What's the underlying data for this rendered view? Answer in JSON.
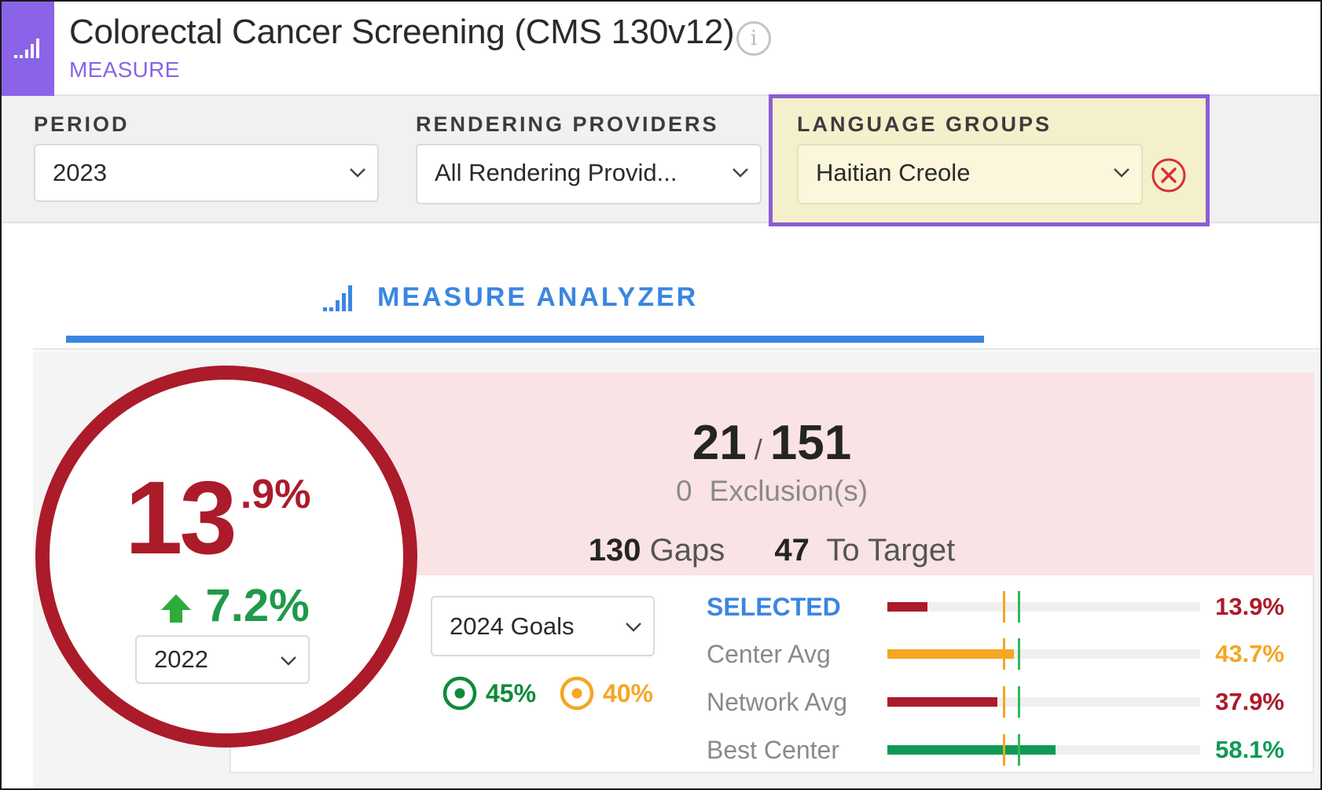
{
  "header": {
    "title": "Colorectal Cancer Screening (CMS 130v12)",
    "subtitle": "MEASURE",
    "info_glyph": "i"
  },
  "filters": {
    "period": {
      "label": "PERIOD",
      "value": "2023"
    },
    "providers": {
      "label": "RENDERING PROVIDERS",
      "value": "All Rendering Provid..."
    },
    "language": {
      "label": "LANGUAGE GROUPS",
      "value": "Haitian Creole"
    }
  },
  "tab": {
    "label": "MEASURE ANALYZER"
  },
  "summary": {
    "numerator": "21",
    "slash": "/",
    "denominator": "151",
    "exclusions_count": "0",
    "exclusions_label": "Exclusion(s)",
    "gaps_count": "130",
    "gaps_label": "Gaps",
    "to_target_count": "47",
    "to_target_label": "To Target"
  },
  "score": {
    "integer": "13",
    "decimal": ".9%",
    "delta": "7.2%",
    "compare_year": "2022"
  },
  "goals": {
    "select_label": "2024 Goals",
    "target_primary": "45%",
    "target_secondary": "40%"
  },
  "comparison": {
    "rows": [
      {
        "label": "SELECTED",
        "value": "13.9%",
        "percent": 13.9,
        "color": "#ab1b2a"
      },
      {
        "label": "Center Avg",
        "value": "43.7%",
        "percent": 43.7,
        "color": "#f5a623"
      },
      {
        "label": "Network Avg",
        "value": "37.9%",
        "percent": 37.9,
        "color": "#ab1b2a"
      },
      {
        "label": "Best Center",
        "value": "58.1%",
        "percent": 58.1,
        "color": "#0e9a54"
      }
    ],
    "goal_secondary_percent": 40,
    "goal_primary_percent": 45
  },
  "colors": {
    "accent_purple": "#8b63e8",
    "tab_blue": "#3a86e2",
    "score_red": "#ab1b2a",
    "delta_green": "#1e9a4a",
    "goal_green": "#0e8a3a",
    "goal_orange": "#f5a623"
  },
  "icons": {
    "header": "signal-bars-icon",
    "info": "info-icon",
    "clear": "close-circle-icon",
    "tab": "signal-bars-icon",
    "delta": "arrow-up-icon",
    "goal_primary": "target-icon",
    "goal_secondary": "target-icon"
  }
}
